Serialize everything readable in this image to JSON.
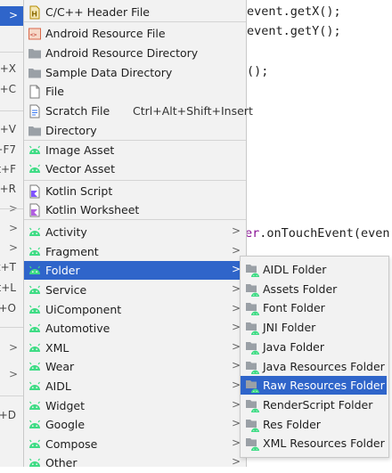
{
  "editor": {
    "lines": [
      "event.getX();",
      "event.getY();",
      "();",
      "er.onTouchEvent(even"
    ]
  },
  "left_strip": {
    "items": [
      {
        "text": "",
        "chevron": ">",
        "selected": true
      },
      {
        "text": "+X"
      },
      {
        "text": "+C"
      },
      {
        "text": ""
      },
      {
        "text": "+V"
      },
      {
        "text": "+F7"
      },
      {
        "text": "t+F"
      },
      {
        "text": "+R"
      },
      {
        "chevron": ">"
      },
      {
        "chevron": ">"
      },
      {
        "chevron": ">"
      },
      {
        "text": "t+T"
      },
      {
        "text": "t+L"
      },
      {
        "text": "+O"
      },
      {
        "chevron": ">"
      },
      {
        "chevron": ">"
      },
      {
        "text": "+D"
      }
    ]
  },
  "menu": {
    "items": [
      {
        "label": "C/C++ Header File",
        "icon": "h-file-icon"
      },
      {
        "label": "Android Resource File",
        "icon": "android-resource-file-icon"
      },
      {
        "label": "Android Resource Directory",
        "icon": "folder-icon"
      },
      {
        "label": "Sample Data Directory",
        "icon": "folder-icon"
      },
      {
        "label": "File",
        "icon": "file-icon"
      },
      {
        "label": "Scratch File",
        "shortcut": "Ctrl+Alt+Shift+Insert",
        "icon": "scratch-file-icon"
      },
      {
        "label": "Directory",
        "icon": "folder-icon"
      },
      {
        "label": "Image Asset",
        "icon": "android-icon"
      },
      {
        "label": "Vector Asset",
        "icon": "android-icon"
      },
      {
        "label": "Kotlin Script",
        "icon": "kotlin-script-icon"
      },
      {
        "label": "Kotlin Worksheet",
        "icon": "kotlin-worksheet-icon"
      },
      {
        "label": "Activity",
        "icon": "android-icon",
        "submenu": true
      },
      {
        "label": "Fragment",
        "icon": "android-icon",
        "submenu": true
      },
      {
        "label": "Folder",
        "icon": "android-icon",
        "submenu": true,
        "selected": true
      },
      {
        "label": "Service",
        "icon": "android-icon",
        "submenu": true
      },
      {
        "label": "UiComponent",
        "icon": "android-icon",
        "submenu": true
      },
      {
        "label": "Automotive",
        "icon": "android-icon",
        "submenu": true
      },
      {
        "label": "XML",
        "icon": "android-icon",
        "submenu": true
      },
      {
        "label": "Wear",
        "icon": "android-icon",
        "submenu": true
      },
      {
        "label": "AIDL",
        "icon": "android-icon",
        "submenu": true
      },
      {
        "label": "Widget",
        "icon": "android-icon",
        "submenu": true
      },
      {
        "label": "Google",
        "icon": "android-icon",
        "submenu": true
      },
      {
        "label": "Compose",
        "icon": "android-icon",
        "submenu": true
      },
      {
        "label": "Other",
        "icon": "android-icon",
        "submenu": true
      }
    ],
    "chevron": ">"
  },
  "submenu": {
    "items": [
      {
        "label": "AIDL Folder"
      },
      {
        "label": "Assets Folder"
      },
      {
        "label": "Font Folder"
      },
      {
        "label": "JNI Folder"
      },
      {
        "label": "Java Folder"
      },
      {
        "label": "Java Resources Folder"
      },
      {
        "label": "Raw Resources Folder",
        "selected": true
      },
      {
        "label": "RenderScript Folder"
      },
      {
        "label": "Res Folder"
      },
      {
        "label": "XML Resources Folder"
      }
    ]
  },
  "colors": {
    "selection": "#2f65ca",
    "menu_bg": "#f2f2f2",
    "android_green": "#3ddc84",
    "keyword": "#871094"
  }
}
